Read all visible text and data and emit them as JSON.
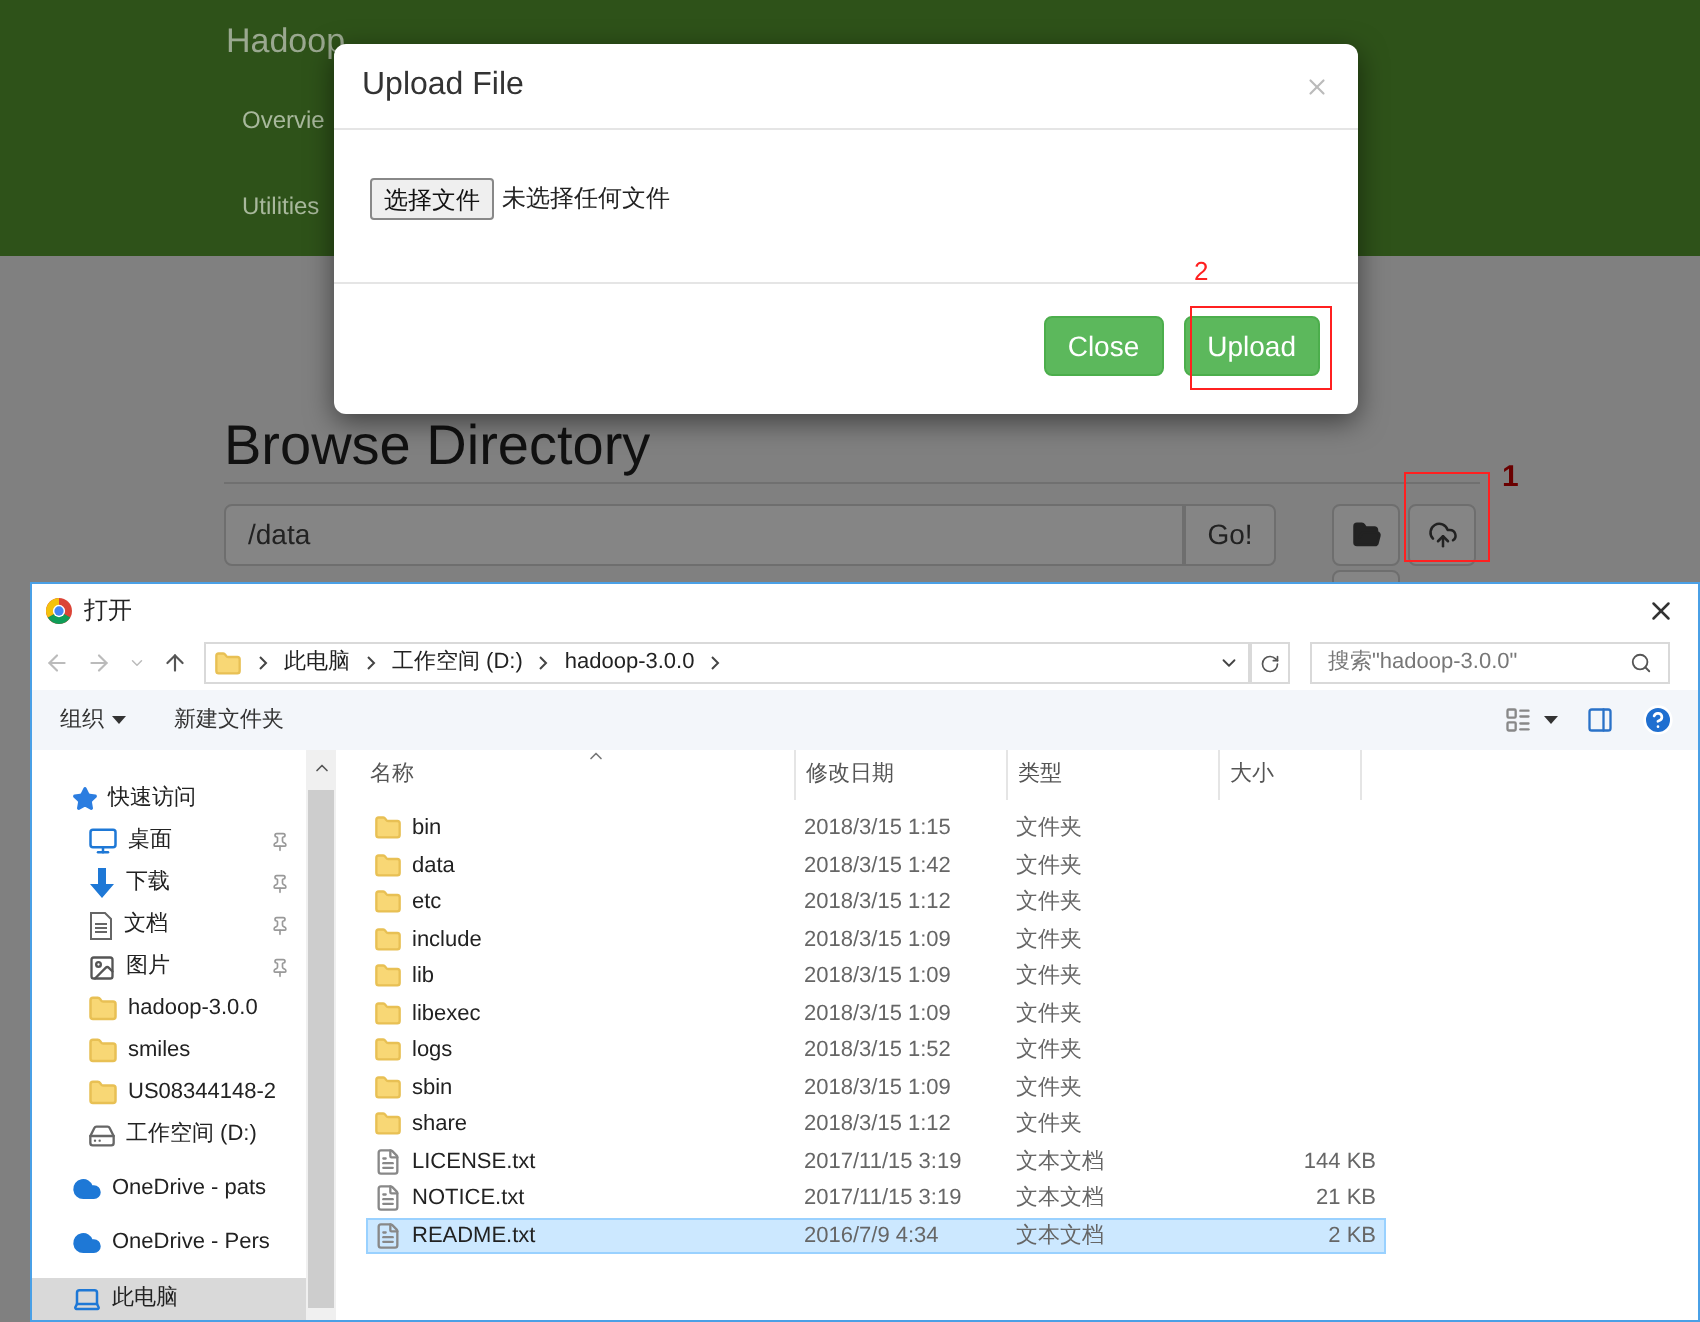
{
  "navbar": {
    "brand": "Hadoop",
    "links": [
      "Overvie",
      "Utilities"
    ]
  },
  "page": {
    "heading": "Browse Directory",
    "path_value": "/data",
    "go_button": "Go!"
  },
  "modal": {
    "title": "Upload File",
    "choose_button": "选择文件",
    "no_file": "未选择任何文件",
    "buttons": [
      "Close",
      "Upload"
    ]
  },
  "annotations": [
    {
      "label": "1"
    },
    {
      "label": "2"
    }
  ],
  "open_dialog": {
    "title": "打开",
    "breadcrumb": [
      "此电脑",
      "工作空间 (D:)",
      "hadoop-3.0.0"
    ],
    "search": {
      "placeholder": "搜索\"hadoop-3.0.0\""
    },
    "toolbar": [
      {
        "label": "组织",
        "dropdown": true
      },
      {
        "label": "新建文件夹",
        "dropdown": false
      }
    ],
    "nav": [
      {
        "label": "快速访问",
        "kind": "star",
        "selected": false,
        "children": [
          {
            "label": "桌面",
            "kind": "desktop",
            "pinned": true,
            "selected": false
          },
          {
            "label": "下载",
            "kind": "download",
            "pinned": true,
            "selected": false
          },
          {
            "label": "文档",
            "kind": "document",
            "pinned": true,
            "selected": false
          },
          {
            "label": "图片",
            "kind": "picture",
            "pinned": true,
            "selected": false
          },
          {
            "label": "hadoop-3.0.0",
            "kind": "folder",
            "pinned": false,
            "selected": false
          },
          {
            "label": "smiles",
            "kind": "folder",
            "pinned": false,
            "selected": false
          },
          {
            "label": "US08344148-2",
            "kind": "folder",
            "pinned": false,
            "selected": false
          },
          {
            "label": "工作空间 (D:)",
            "kind": "drive",
            "pinned": false,
            "selected": false
          }
        ]
      },
      {
        "label": "OneDrive - pats",
        "kind": "cloud",
        "selected": false
      },
      {
        "label": "OneDrive - Pers",
        "kind": "cloud",
        "selected": false
      },
      {
        "label": "此电脑",
        "kind": "computer",
        "selected": true
      }
    ],
    "columns": [
      "名称",
      "修改日期",
      "类型",
      "大小"
    ],
    "files": [
      {
        "name": "bin",
        "date": "2018/3/15 1:15",
        "type": "文件夹",
        "kind": "folder",
        "selected": false
      },
      {
        "name": "data",
        "date": "2018/3/15 1:42",
        "type": "文件夹",
        "kind": "folder",
        "selected": false
      },
      {
        "name": "etc",
        "date": "2018/3/15 1:12",
        "type": "文件夹",
        "kind": "folder",
        "selected": false
      },
      {
        "name": "include",
        "date": "2018/3/15 1:09",
        "type": "文件夹",
        "kind": "folder",
        "selected": false
      },
      {
        "name": "lib",
        "date": "2018/3/15 1:09",
        "type": "文件夹",
        "kind": "folder",
        "selected": false
      },
      {
        "name": "libexec",
        "date": "2018/3/15 1:09",
        "type": "文件夹",
        "kind": "folder",
        "selected": false
      },
      {
        "name": "logs",
        "date": "2018/3/15 1:52",
        "type": "文件夹",
        "kind": "folder",
        "selected": false
      },
      {
        "name": "sbin",
        "date": "2018/3/15 1:09",
        "type": "文件夹",
        "kind": "folder",
        "selected": false
      },
      {
        "name": "share",
        "date": "2018/3/15 1:12",
        "type": "文件夹",
        "kind": "folder",
        "selected": false
      },
      {
        "name": "LICENSE.txt",
        "date": "2017/11/15 3:19",
        "type": "文本文档",
        "size": "144 KB",
        "kind": "text",
        "selected": false
      },
      {
        "name": "NOTICE.txt",
        "date": "2017/11/15 3:19",
        "type": "文本文档",
        "size": "21 KB",
        "kind": "text",
        "selected": false
      },
      {
        "name": "README.txt",
        "date": "2016/7/9 4:34",
        "type": "文本文档",
        "size": "2 KB",
        "kind": "text",
        "selected": true
      }
    ]
  }
}
